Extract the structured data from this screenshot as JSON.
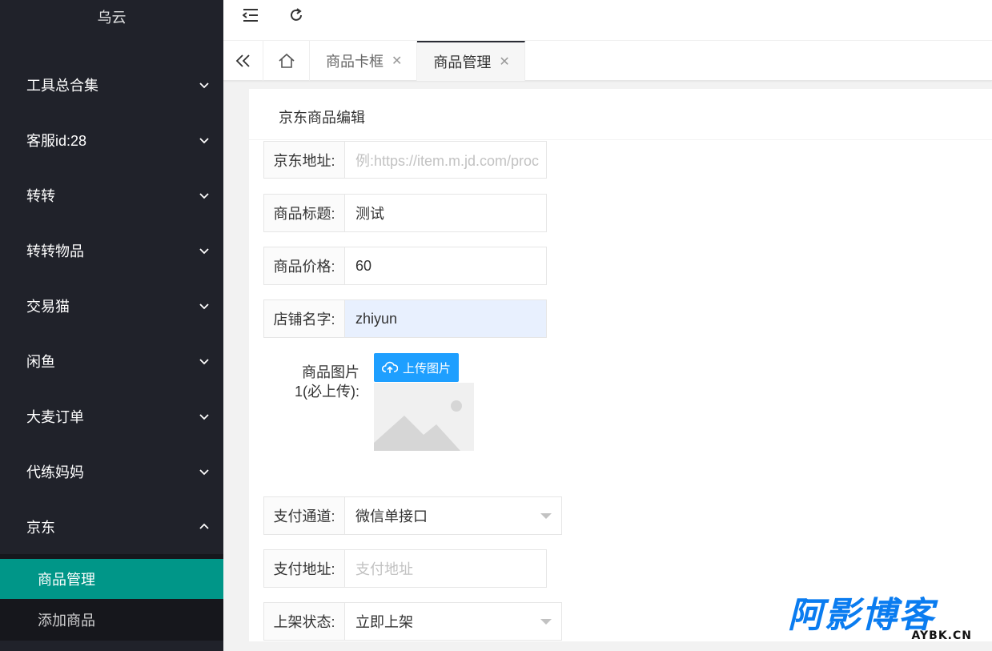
{
  "sidebar": {
    "logo": "乌云",
    "items": [
      {
        "label": "工具总合集"
      },
      {
        "label": "客服id:28"
      },
      {
        "label": "转转"
      },
      {
        "label": "转转物品"
      },
      {
        "label": "交易猫"
      },
      {
        "label": "闲鱼"
      },
      {
        "label": "大麦订单"
      },
      {
        "label": "代练妈妈"
      },
      {
        "label": "京东"
      }
    ],
    "sub_items": [
      {
        "label": "商品管理"
      },
      {
        "label": "添加商品"
      }
    ]
  },
  "tabs": [
    {
      "label": "商品卡框",
      "close": "✕"
    },
    {
      "label": "商品管理",
      "close": "✕"
    }
  ],
  "form": {
    "title": "京东商品编辑",
    "jd_url": {
      "label": "京东地址:",
      "placeholder": "例:https://item.m.jd.com/proc"
    },
    "product_title": {
      "label": "商品标题:",
      "value": "测试"
    },
    "product_price": {
      "label": "商品价格:",
      "value": "60"
    },
    "shop_name": {
      "label": "店铺名字:",
      "value": "zhiyun"
    },
    "image": {
      "label_line1": "商品图片",
      "label_line2": "1(必上传):",
      "button": "上传图片"
    },
    "pay_channel": {
      "label": "支付通道:",
      "value": "微信单接口"
    },
    "pay_url": {
      "label": "支付地址:",
      "placeholder": "支付地址"
    },
    "listing_status": {
      "label": "上架状态:",
      "value": "立即上架"
    }
  },
  "watermark": {
    "main": "阿影博客",
    "sub": "AYBK.CN"
  },
  "colors": {
    "sidebar": "#20222a",
    "active": "#009688",
    "upload": "#1e9fff",
    "watermark": "#0a7cf0"
  }
}
